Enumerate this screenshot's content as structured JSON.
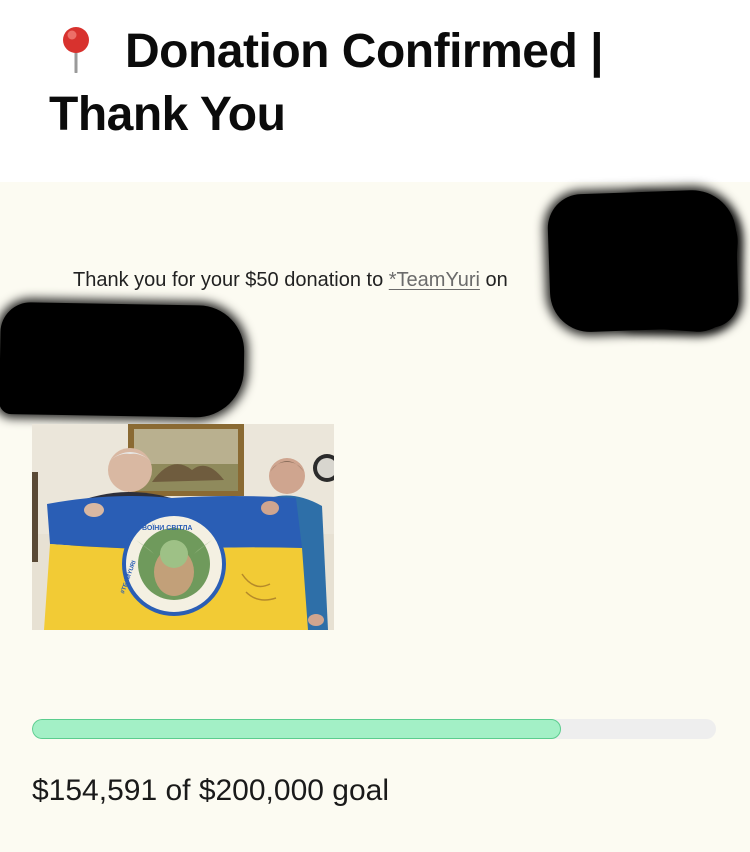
{
  "header": {
    "title": "Donation Confirmed | Thank You",
    "title_icon": "round-pushpin-icon"
  },
  "message": {
    "prefix": "Thank you for your $50 donation to ",
    "link_text": "*TeamYuri",
    "suffix": " on"
  },
  "photo": {
    "flag_text": "ВОЇНИ СВІТЛА",
    "flag_side_text": "#TEAMYURI"
  },
  "fundraiser": {
    "raised": "$154,591",
    "goal": "$200,000",
    "progress_percent": 77.3,
    "summary": "$154,591 of $200,000 goal"
  },
  "colors": {
    "page_background": "#ffffff",
    "content_background": "#fcfbf2",
    "progress_fill": "#a3f0c6",
    "progress_fill_border": "#5bcd8e",
    "progress_track": "#eeeeee",
    "link": "#6b6b6b"
  }
}
